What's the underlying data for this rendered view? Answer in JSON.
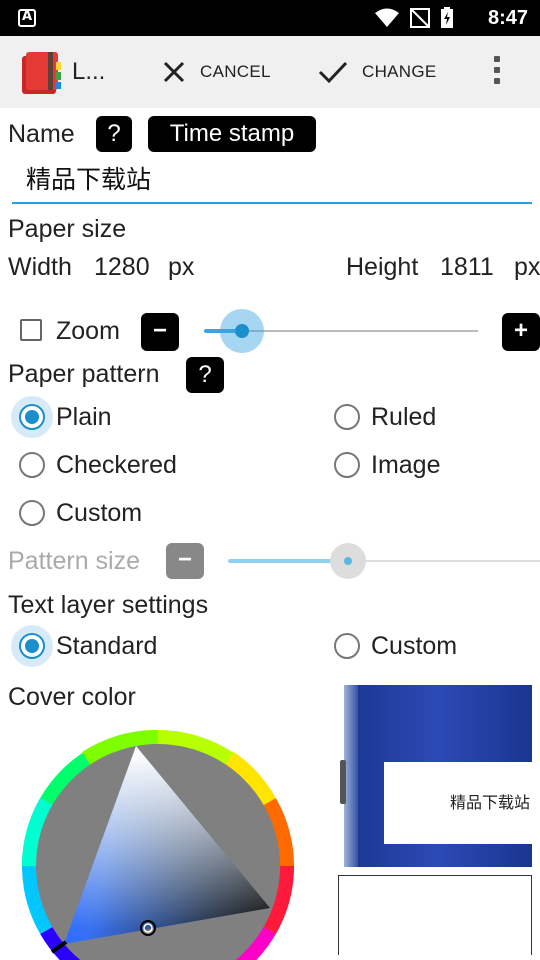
{
  "status": {
    "time": "8:47"
  },
  "toolbar": {
    "title": "L...",
    "cancel_label": "CANCEL",
    "change_label": "CHANGE"
  },
  "name": {
    "label": "Name",
    "help": "?",
    "chip": "Time stamp",
    "value": "精品下载站"
  },
  "paper_size": {
    "label": "Paper size",
    "width_label": "Width",
    "width_value": "1280",
    "width_unit": "px",
    "height_label": "Height",
    "height_value": "1811",
    "height_unit": "px"
  },
  "zoom": {
    "label": "Zoom",
    "checked": false,
    "minus": "−",
    "plus": "+"
  },
  "paper_pattern": {
    "label": "Paper pattern",
    "help": "?",
    "options": [
      "Plain",
      "Ruled",
      "Checkered",
      "Image",
      "Custom"
    ],
    "selected": "Plain"
  },
  "pattern_size": {
    "label": "Pattern size",
    "minus": "−"
  },
  "text_layer": {
    "label": "Text layer settings",
    "options": [
      "Standard",
      "Custom"
    ],
    "selected": "Standard"
  },
  "cover_color": {
    "label": "Cover color",
    "preview_text": "精品下载站"
  }
}
